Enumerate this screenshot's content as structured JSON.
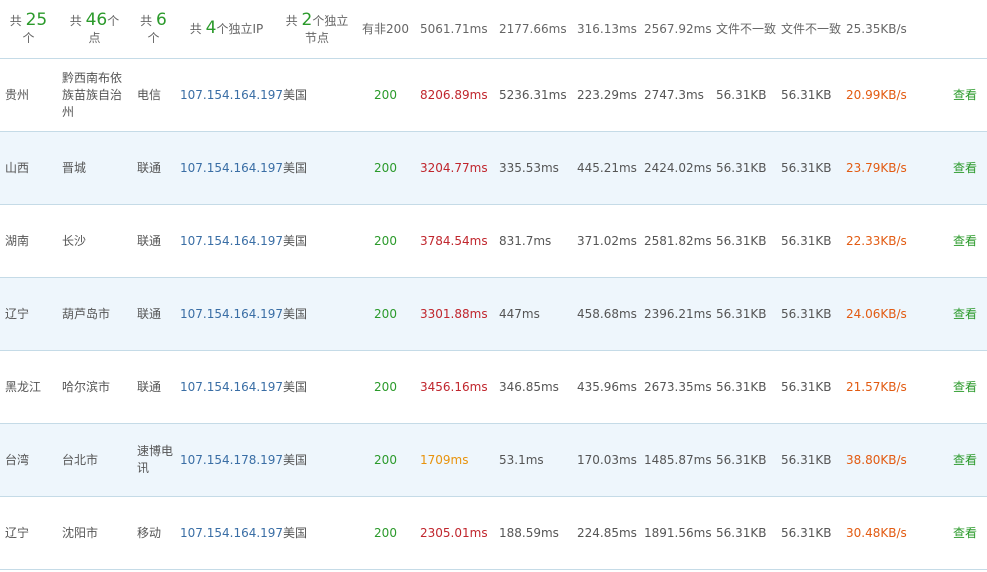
{
  "summary": {
    "provinces_prefix": "共",
    "provinces_count": "25",
    "provinces_suffix": "个",
    "cities_prefix": "共",
    "cities_count": "46",
    "cities_suffix": "个",
    "cities_suffix2": "点",
    "isp_prefix": "共",
    "isp_count": "6",
    "isp_suffix": "个",
    "ip_prefix": "共",
    "ip_count": "4",
    "ip_suffix": "个独立IP",
    "node_prefix": "共",
    "node_count": "2",
    "node_suffix": "个独立",
    "node_suffix2": "节点",
    "status": "有非200",
    "total_time": "5061.71ms",
    "dns_time": "2177.66ms",
    "connect_time": "316.13ms",
    "download_time": "2567.92ms",
    "file_size_note": "文件不一致",
    "file_size_note2": "文件不一致",
    "speed": "25.35KB/s"
  },
  "rows": [
    {
      "province": "贵州",
      "city": "黔西南布依族苗族自治州",
      "isp": "电信",
      "ip": "107.154.164.197",
      "location": "美国",
      "status": "200",
      "total": "8206.89ms",
      "total_color": "red",
      "dns": "5236.31ms",
      "connect": "223.29ms",
      "download": "2747.3ms",
      "size1": "56.31KB",
      "size2": "56.31KB",
      "speed": "20.99KB/s",
      "action": "查看"
    },
    {
      "province": "山西",
      "city": "晋城",
      "isp": "联通",
      "ip": "107.154.164.197",
      "location": "美国",
      "status": "200",
      "total": "3204.77ms",
      "total_color": "red",
      "dns": "335.53ms",
      "connect": "445.21ms",
      "download": "2424.02ms",
      "size1": "56.31KB",
      "size2": "56.31KB",
      "speed": "23.79KB/s",
      "action": "查看"
    },
    {
      "province": "湖南",
      "city": "长沙",
      "isp": "联通",
      "ip": "107.154.164.197",
      "location": "美国",
      "status": "200",
      "total": "3784.54ms",
      "total_color": "red",
      "dns": "831.7ms",
      "connect": "371.02ms",
      "download": "2581.82ms",
      "size1": "56.31KB",
      "size2": "56.31KB",
      "speed": "22.33KB/s",
      "action": "查看"
    },
    {
      "province": "辽宁",
      "city": "葫芦岛市",
      "isp": "联通",
      "ip": "107.154.164.197",
      "location": "美国",
      "status": "200",
      "total": "3301.88ms",
      "total_color": "red",
      "dns": "447ms",
      "connect": "458.68ms",
      "download": "2396.21ms",
      "size1": "56.31KB",
      "size2": "56.31KB",
      "speed": "24.06KB/s",
      "action": "查看"
    },
    {
      "province": "黑龙江",
      "city": "哈尔滨市",
      "isp": "联通",
      "ip": "107.154.164.197",
      "location": "美国",
      "status": "200",
      "total": "3456.16ms",
      "total_color": "red",
      "dns": "346.85ms",
      "connect": "435.96ms",
      "download": "2673.35ms",
      "size1": "56.31KB",
      "size2": "56.31KB",
      "speed": "21.57KB/s",
      "action": "查看"
    },
    {
      "province": "台湾",
      "city": "台北市",
      "isp": "速博电讯",
      "ip": "107.154.178.197",
      "location": "美国",
      "status": "200",
      "total": "1709ms",
      "total_color": "orange",
      "dns": "53.1ms",
      "connect": "170.03ms",
      "download": "1485.87ms",
      "size1": "56.31KB",
      "size2": "56.31KB",
      "speed": "38.80KB/s",
      "action": "查看"
    },
    {
      "province": "辽宁",
      "city": "沈阳市",
      "isp": "移动",
      "ip": "107.154.164.197",
      "location": "美国",
      "status": "200",
      "total": "2305.01ms",
      "total_color": "red",
      "dns": "188.59ms",
      "connect": "224.85ms",
      "download": "1891.56ms",
      "size1": "56.31KB",
      "size2": "56.31KB",
      "speed": "30.48KB/s",
      "action": "查看"
    }
  ],
  "colors": {
    "red": "#c0262d",
    "orange": "#e8930c",
    "green": "#2b9a2b",
    "ip_blue": "#3a6ea5",
    "speed_orange": "#e25b12",
    "row_alt": "#eef6fc",
    "border": "#c5dbe7"
  }
}
